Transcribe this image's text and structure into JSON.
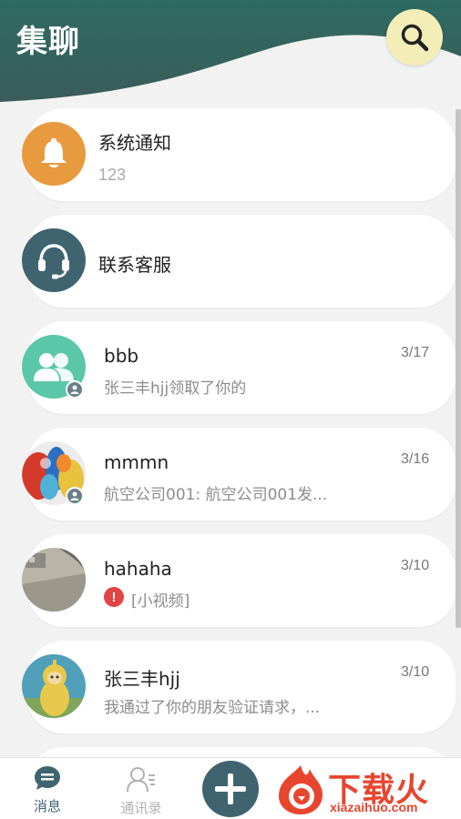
{
  "header": {
    "title": "集聊",
    "search_icon": "search-icon",
    "colors": {
      "top": "#2e6b62",
      "bottom": "#3b5e5c",
      "accent": "#f3eeb7"
    }
  },
  "conversations": [
    {
      "title": "系统通知",
      "subtitle": "123",
      "date": "",
      "avatar": "bell-icon",
      "avatar_color": "#e89a3f"
    },
    {
      "title": "联系客服",
      "subtitle": "",
      "date": "",
      "avatar": "headset-icon",
      "avatar_color": "#3f6470"
    },
    {
      "title": "bbb",
      "subtitle": "张三丰hjj领取了你的",
      "date": "3/17",
      "avatar": "group-icon",
      "avatar_color": "#5ac8a8"
    },
    {
      "title": "mmmn",
      "subtitle": "航空公司001: 航空公司001发...",
      "date": "3/16",
      "avatar": "photo-colorful",
      "avatar_color": "#d84b3a"
    },
    {
      "title": "hahaha",
      "subtitle": "[小视频]",
      "date": "3/10",
      "avatar": "photo-gray",
      "avatar_color": "#9a9a8e",
      "alert_icon": "error-icon"
    },
    {
      "title": "张三丰hjj",
      "subtitle": "我通过了你的朋友验证请求，...",
      "date": "3/10",
      "avatar": "photo-toy",
      "avatar_color": "#e0c64a"
    }
  ],
  "tabbar": {
    "messages_label": "消息",
    "contacts_label": "通讯录",
    "add_icon": "plus-icon",
    "active_color": "#3f6470",
    "inactive_color": "#b0b0b0"
  },
  "watermark": {
    "text": "下载火",
    "domain": "xiazaihuo.com"
  }
}
